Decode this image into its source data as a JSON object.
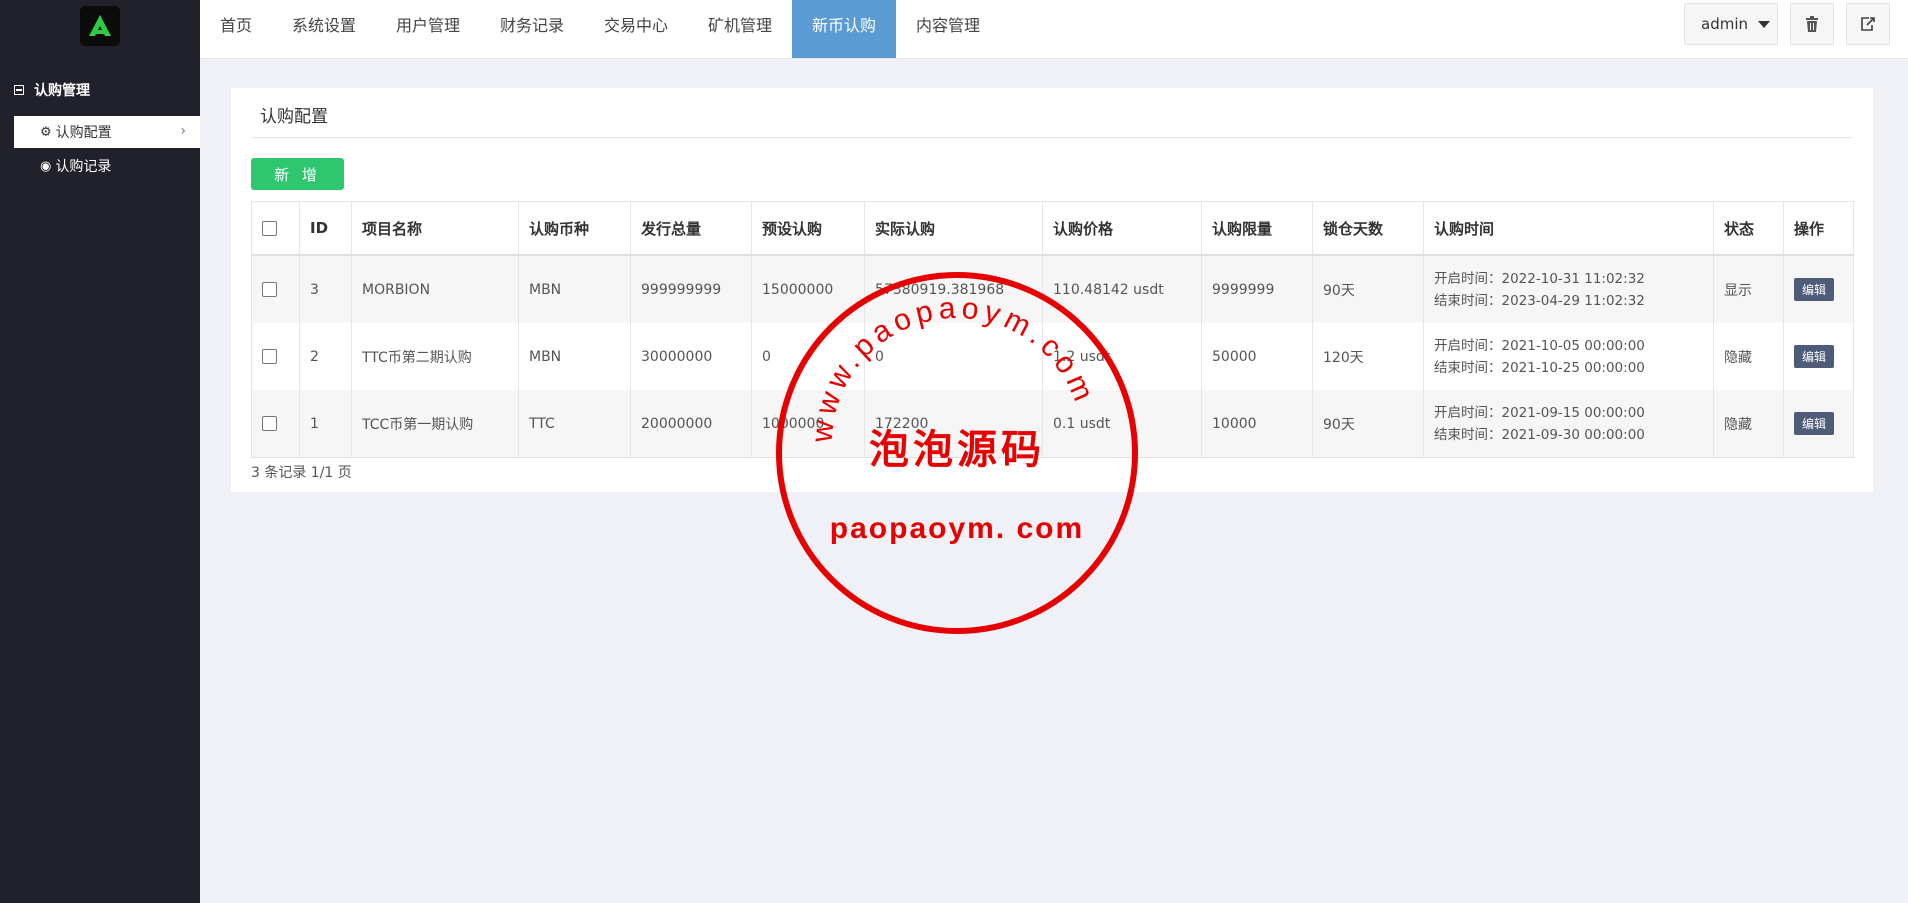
{
  "topnav": {
    "items": [
      {
        "label": "首页"
      },
      {
        "label": "系统设置"
      },
      {
        "label": "用户管理"
      },
      {
        "label": "财务记录"
      },
      {
        "label": "交易中心"
      },
      {
        "label": "矿机管理"
      },
      {
        "label": "新币认购",
        "active": true
      },
      {
        "label": "内容管理"
      }
    ],
    "user_label": "admin",
    "icons": [
      "trash-icon",
      "logout-icon"
    ]
  },
  "sidebar": {
    "group_label": "认购管理",
    "items": [
      {
        "label": "认购配置",
        "icon": "gear-icon",
        "active": true
      },
      {
        "label": "认购记录",
        "icon": "globe-icon"
      }
    ]
  },
  "panel": {
    "title": "认购配置",
    "add_button": "新 增",
    "columns": [
      "ID",
      "项目名称",
      "认购币种",
      "发行总量",
      "预设认购",
      "实际认购",
      "认购价格",
      "认购限量",
      "锁仓天数",
      "认购时间",
      "状态",
      "操作"
    ],
    "rows": [
      {
        "id": "3",
        "name": "MORBION",
        "coin": "MBN",
        "total": "999999999",
        "preset": "15000000",
        "actual": "57380919.381968",
        "price": "110.48142 usdt",
        "limit": "9999999",
        "lock_days": "90天",
        "start": "开启时间：2022-10-31 11:02:32",
        "end": "结束时间：2023-04-29 11:02:32",
        "status": "显示",
        "action": "编辑"
      },
      {
        "id": "2",
        "name": "TTC币第二期认购",
        "coin": "MBN",
        "total": "30000000",
        "preset": "0",
        "actual": "0",
        "price": "1.2 usdt",
        "limit": "50000",
        "lock_days": "120天",
        "start": "开启时间：2021-10-05 00:00:00",
        "end": "结束时间：2021-10-25 00:00:00",
        "status": "隐藏",
        "action": "编辑"
      },
      {
        "id": "1",
        "name": "TCC币第一期认购",
        "coin": "TTC",
        "total": "20000000",
        "preset": "1000000",
        "actual": "172200",
        "price": "0.1 usdt",
        "limit": "10000",
        "lock_days": "90天",
        "start": "开启时间：2021-09-15 00:00:00",
        "end": "结束时间：2021-09-30 00:00:00",
        "status": "隐藏",
        "action": "编辑"
      }
    ],
    "pager": "3 条记录 1/1 页"
  },
  "watermark": {
    "arc_text": "www.paopaoym.com",
    "center_text": "泡泡源码",
    "bottom_text": "paopaoym. com",
    "color": "#e60000"
  }
}
